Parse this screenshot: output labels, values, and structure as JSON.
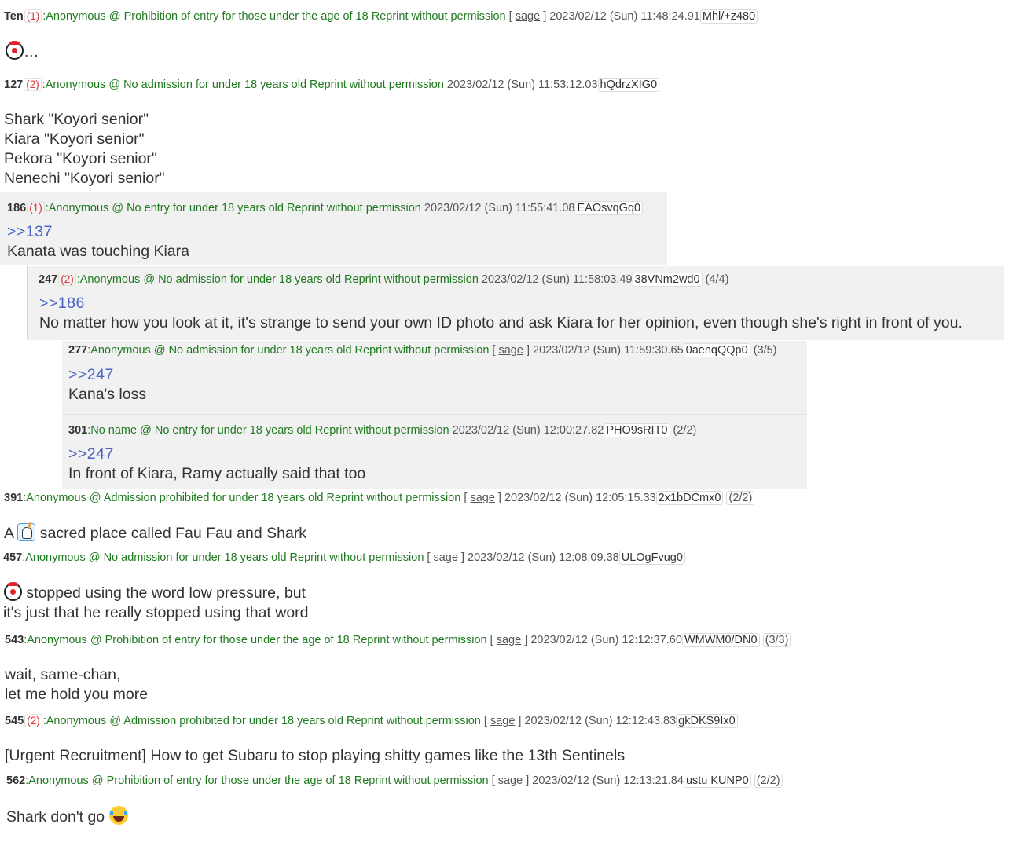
{
  "posts": [
    {
      "num": "Ten",
      "count": "(1)",
      "meta": ":Anonymous @ Prohibition of entry for those under the age of 18 Reprint without permission",
      "sage_open": "[",
      "sage": "sage",
      "sage_close": "]",
      "date": "2023/02/12 (Sun) 11:48:24.91",
      "id": "Mhl/+z480",
      "lines": [
        "…"
      ]
    },
    {
      "num": "127",
      "count": "(2)",
      "meta": ":Anonymous @ No admission for under 18 years old Reprint without permission",
      "date": "2023/02/12 (Sun) 11:53:12.03",
      "id": "hQdrzXIG0",
      "lines": [
        "Shark \"Koyori senior\"",
        "Kiara \"Koyori senior\"",
        "Pekora \"Koyori senior\"",
        "Nenechi \"Koyori senior\""
      ]
    },
    {
      "num": "186",
      "count": "(1)",
      "meta": ":Anonymous @ No entry for under 18 years old Reprint without permission",
      "date": "2023/02/12 (Sun) 11:55:41.08",
      "id": "EAOsvqGq0",
      "anchor": ">>137",
      "lines": [
        "Kanata was touching Kiara"
      ]
    },
    {
      "num": "247",
      "count": "(2)",
      "meta": ":Anonymous @ No admission for under 18 years old Reprint without permission",
      "date": "2023/02/12 (Sun) 11:58:03.49",
      "id": "38VNm2wd0",
      "id_count": "(4/4)",
      "anchor": ">>186",
      "lines": [
        "No matter how you look at it, it's strange to send your own ID photo and ask Kiara for her opinion, even though she's right in front of you."
      ]
    },
    {
      "num": "277",
      "meta": ":Anonymous @ No admission for under 18 years old Reprint without permission",
      "sage_open": "[",
      "sage": "sage",
      "sage_close": "]",
      "date": "2023/02/12 (Sun) 11:59:30.65",
      "id": "0aenqQQp0",
      "id_count": "(3/5)",
      "anchor": ">>247",
      "lines": [
        "Kana's loss"
      ]
    },
    {
      "num": "301",
      "meta": ":No name @ No entry for under 18 years old Reprint without permission",
      "date": "2023/02/12 (Sun) 12:00:27.82",
      "id": "PHO9sRIT0",
      "id_count": "(2/2)",
      "anchor": ">>247",
      "lines": [
        "In front of Kiara, Ramy actually said that too"
      ]
    },
    {
      "num": "391",
      "meta": ":Anonymous @ Admission prohibited for under 18 years old Reprint without permission",
      "sage_open": "[",
      "sage": "sage",
      "sage_close": "]",
      "date": "2023/02/12 (Sun) 12:05:15.33",
      "id": "2x1bDCmx0",
      "id_count": "(2/2)",
      "lines_pre": "A",
      "lines_post": "sacred place called Fau Fau and Shark"
    },
    {
      "num": "457",
      "meta": ":Anonymous @ No admission for under 18 years old Reprint without permission",
      "sage_open": "[",
      "sage": "sage",
      "sage_close": "]",
      "date": "2023/02/12 (Sun) 12:08:09.38",
      "id": "ULOgFvug0",
      "line1_post": "stopped using the word low pressure, but",
      "line2": "it's just that he really stopped using that word"
    },
    {
      "num": "543",
      "meta": ":Anonymous @ Prohibition of entry for those under the age of 18 Reprint without permission",
      "sage_open": "[",
      "sage": "sage",
      "sage_close": "]",
      "date": "2023/02/12 (Sun) 12:12:37.60",
      "id": "WMWM0/DN0",
      "id_count": "(3/3)",
      "lines": [
        "wait, same-chan,",
        "let me hold you more"
      ]
    },
    {
      "num": "545",
      "count": "(2)",
      "meta": ":Anonymous @ Admission prohibited for under 18 years old Reprint without permission",
      "sage_open": "[",
      "sage": "sage",
      "sage_close": "]",
      "date": "2023/02/12 (Sun) 12:12:43.83",
      "id": "gkDKS9Ix0",
      "lines": [
        "[Urgent Recruitment] How to get Subaru to stop playing shitty games like the 13th Sentinels"
      ]
    },
    {
      "num": "562",
      "meta": ":Anonymous @ Prohibition of entry for those under the age of 18 Reprint without permission",
      "sage_open": "[",
      "sage": "sage",
      "sage_close": "]",
      "date": "2023/02/12 (Sun) 12:13:21.84",
      "id": "ustu KUNP0",
      "id_count": "(2/2)",
      "lines_pre": "Shark don't go"
    }
  ],
  "icons": [
    "clown-icon",
    "unicorn-icon",
    "clown-icon",
    "crying-face-icon"
  ]
}
